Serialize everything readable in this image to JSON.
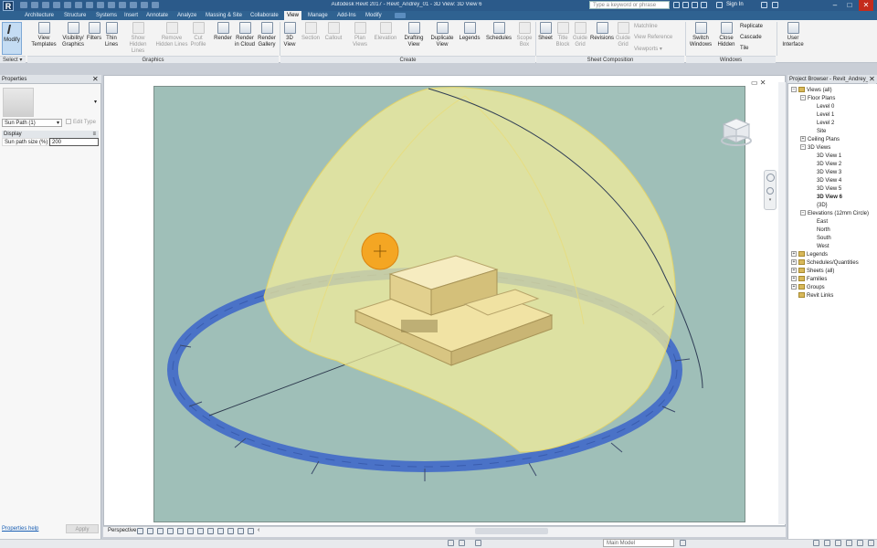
{
  "app": {
    "logo_letter": "R",
    "document_title": "Autodesk Revit 2017 -  Revit_Andrey_01 - 3D View: 3D View 6",
    "search_placeholder": "Type a keyword or phrase",
    "sign_in": "Sign In",
    "window_controls": [
      "–",
      "□",
      "✕"
    ]
  },
  "ribbon_tabs": [
    "Architecture",
    "Structure",
    "Systems",
    "Insert",
    "Annotate",
    "Analyze",
    "Massing & Site",
    "Collaborate",
    "View",
    "Manage",
    "Add-Ins",
    "Modify"
  ],
  "active_tab": "View",
  "ribbon": {
    "modify_label": "Modify",
    "select_label": "Select ▾",
    "panels": [
      {
        "label": "Graphics"
      },
      {
        "label": "Create"
      },
      {
        "label": "Sheet Composition"
      },
      {
        "label": "Windows"
      }
    ],
    "buttons": [
      {
        "label": "View Templates",
        "enabled": true
      },
      {
        "label": "Visibility/ Graphics",
        "enabled": true
      },
      {
        "label": "Filters",
        "enabled": true
      },
      {
        "label": "Thin Lines",
        "enabled": true
      },
      {
        "label": "Show Hidden Lines",
        "enabled": false
      },
      {
        "label": "Remove Hidden Lines",
        "enabled": false
      },
      {
        "label": "Cut Profile",
        "enabled": false
      },
      {
        "label": "Render",
        "enabled": true
      },
      {
        "label": "Render in Cloud",
        "enabled": true
      },
      {
        "label": "Render Gallery",
        "enabled": true
      },
      {
        "label": "3D View",
        "enabled": true
      },
      {
        "label": "Section",
        "enabled": false
      },
      {
        "label": "Callout",
        "enabled": false
      },
      {
        "label": "Plan Views",
        "enabled": false
      },
      {
        "label": "Elevation",
        "enabled": false
      },
      {
        "label": "Drafting View",
        "enabled": true
      },
      {
        "label": "Duplicate View",
        "enabled": true
      },
      {
        "label": "Legends",
        "enabled": true
      },
      {
        "label": "Schedules",
        "enabled": true
      },
      {
        "label": "Scope Box",
        "enabled": false
      },
      {
        "label": "Sheet",
        "enabled": true
      },
      {
        "label": "Title Block",
        "enabled": false
      },
      {
        "label": "Guide Grid",
        "enabled": false
      },
      {
        "label": "Revisions",
        "enabled": true
      },
      {
        "label": "Guide Grid",
        "enabled": false
      },
      {
        "label": "Switch Windows",
        "enabled": true
      },
      {
        "label": "Close Hidden",
        "enabled": true
      },
      {
        "label": "User Interface",
        "enabled": true
      }
    ],
    "sheet_small": [
      "Matchline",
      "View Reference",
      "Viewports ▾"
    ],
    "windows_small": [
      "Replicate",
      "Cascade",
      "Tile"
    ]
  },
  "properties": {
    "title": "Properties",
    "type_selector": "Sun Path (1)",
    "edit_type": "Edit Type",
    "group": "Display",
    "param_label": "Sun path size (%)",
    "param_value": "200",
    "help_link": "Properties help",
    "apply": "Apply"
  },
  "view_bar": {
    "perspective": "Perspective"
  },
  "project_browser": {
    "title": "Project Browser - Revit_Andrey_01",
    "items": [
      {
        "label": "Views (all)",
        "level": 0,
        "toggle": "−",
        "bold": false
      },
      {
        "label": "Floor Plans",
        "level": 1,
        "toggle": "−",
        "bold": false
      },
      {
        "label": "Level 0",
        "level": 2,
        "toggle": "",
        "bold": false
      },
      {
        "label": "Level 1",
        "level": 2,
        "toggle": "",
        "bold": false
      },
      {
        "label": "Level 2",
        "level": 2,
        "toggle": "",
        "bold": false
      },
      {
        "label": "Site",
        "level": 2,
        "toggle": "",
        "bold": false
      },
      {
        "label": "Ceiling Plans",
        "level": 1,
        "toggle": "+",
        "bold": false
      },
      {
        "label": "3D Views",
        "level": 1,
        "toggle": "−",
        "bold": false
      },
      {
        "label": "3D View 1",
        "level": 2,
        "toggle": "",
        "bold": false
      },
      {
        "label": "3D View 2",
        "level": 2,
        "toggle": "",
        "bold": false
      },
      {
        "label": "3D View 3",
        "level": 2,
        "toggle": "",
        "bold": false
      },
      {
        "label": "3D View 4",
        "level": 2,
        "toggle": "",
        "bold": false
      },
      {
        "label": "3D View 5",
        "level": 2,
        "toggle": "",
        "bold": false
      },
      {
        "label": "3D View 6",
        "level": 2,
        "toggle": "",
        "bold": true
      },
      {
        "label": "{3D}",
        "level": 2,
        "toggle": "",
        "bold": false
      },
      {
        "label": "Elevations (12mm Circle)",
        "level": 1,
        "toggle": "−",
        "bold": false
      },
      {
        "label": "East",
        "level": 2,
        "toggle": "",
        "bold": false
      },
      {
        "label": "North",
        "level": 2,
        "toggle": "",
        "bold": false
      },
      {
        "label": "South",
        "level": 2,
        "toggle": "",
        "bold": false
      },
      {
        "label": "West",
        "level": 2,
        "toggle": "",
        "bold": false
      },
      {
        "label": "Legends",
        "level": 0,
        "toggle": "+",
        "bold": false
      },
      {
        "label": "Schedules/Quantities",
        "level": 0,
        "toggle": "+",
        "bold": false
      },
      {
        "label": "Sheets (all)",
        "level": 0,
        "toggle": "+",
        "bold": false
      },
      {
        "label": "Families",
        "level": 0,
        "toggle": "+",
        "bold": false
      },
      {
        "label": "Groups",
        "level": 0,
        "toggle": "+",
        "bold": false
      },
      {
        "label": "Revit Links",
        "level": 0,
        "toggle": "",
        "bold": false
      }
    ]
  },
  "status_bar": {
    "model": "Main Model"
  },
  "colors": {
    "titlebar": "#2b5a8a",
    "sky_background": "#9fbfb8",
    "sun_path_dome": "#f5ee9a",
    "sun": "#f4a623",
    "compass_ring": "#4a72c7",
    "building": "#f1e3a4"
  },
  "icons": [
    "search-icon",
    "chevron-down-icon",
    "close-icon",
    "sun-icon",
    "viewcube-icon",
    "wheel-nav-icon",
    "zoom-icon"
  ]
}
